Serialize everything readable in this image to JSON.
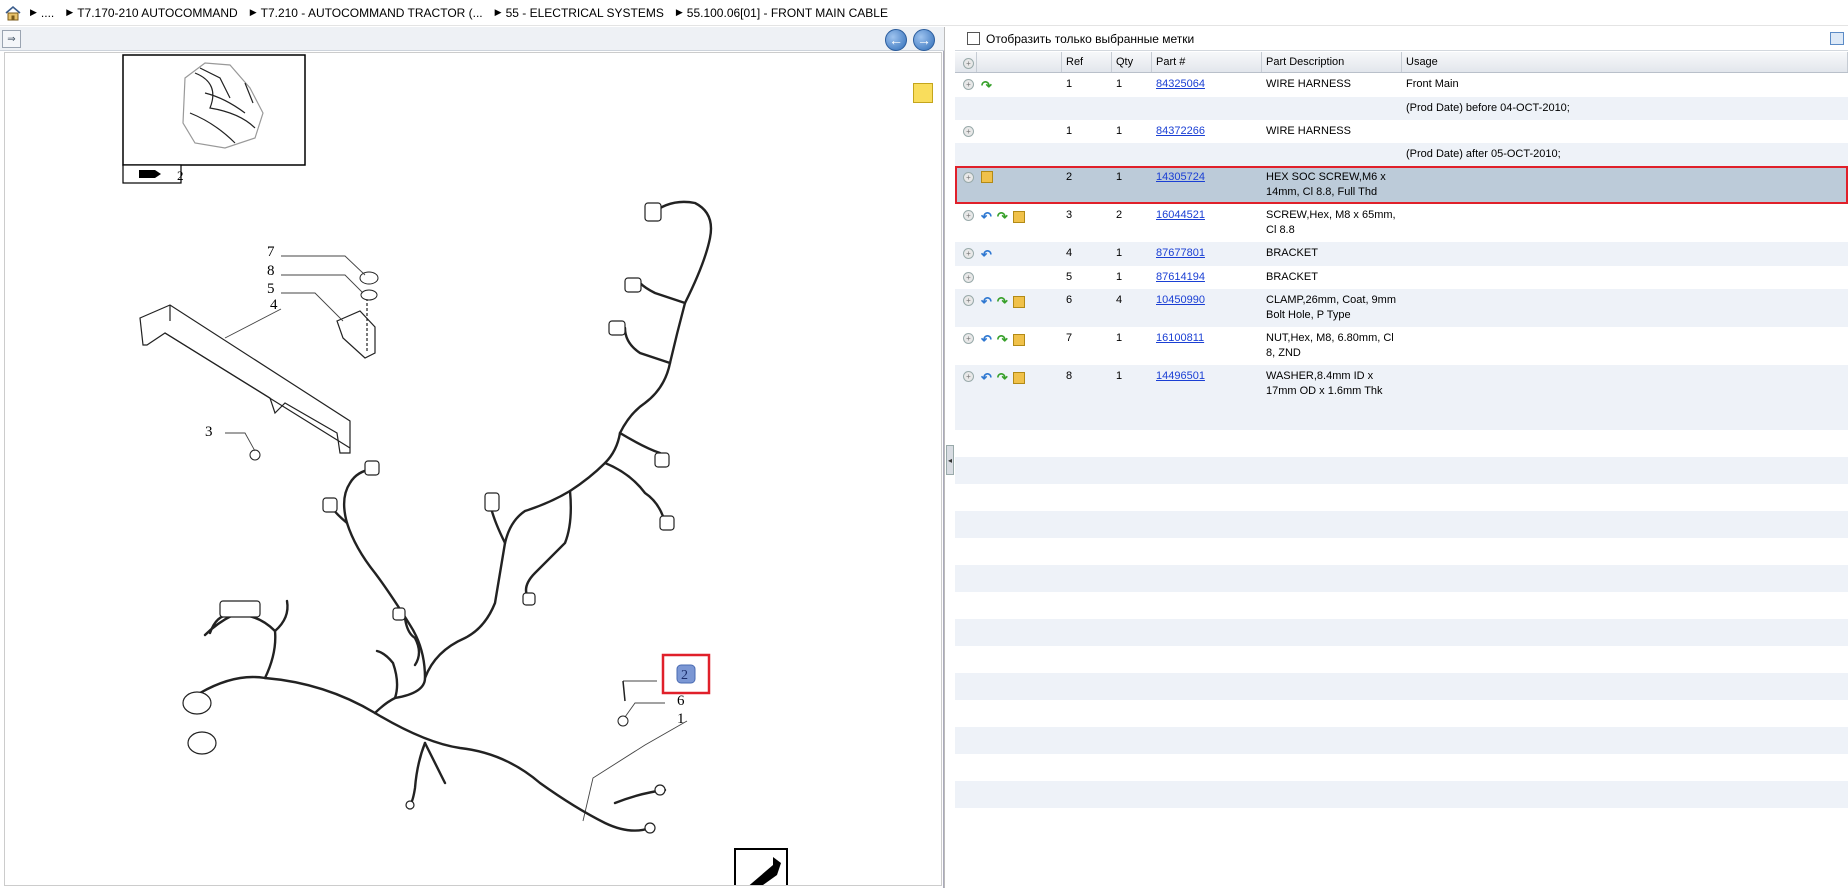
{
  "breadcrumb": [
    {
      "label": "...."
    },
    {
      "label": "T7.170-210 AUTOCOMMAND"
    },
    {
      "label": "T7.210 - AUTOCOMMAND TRACTOR (..."
    },
    {
      "label": "55 - ELECTRICAL SYSTEMS"
    },
    {
      "label": "55.100.06[01] - FRONT MAIN CABLE"
    }
  ],
  "filter": {
    "label": "Отобразить только выбранные метки"
  },
  "grid": {
    "headers": [
      "Ref",
      "Qty",
      "Part #",
      "Part Description",
      "Usage"
    ],
    "rows": [
      {
        "ref": "1",
        "qty": "1",
        "part": "84325064",
        "desc": "WIRE HARNESS",
        "usage": "Front Main",
        "icons": [
          "fwd"
        ],
        "alt": false
      },
      {
        "ref": "",
        "qty": "",
        "part": "",
        "desc": "",
        "usage": "(Prod Date) before 04-OCT-2010;",
        "icons": [],
        "alt": true
      },
      {
        "ref": "1",
        "qty": "1",
        "part": "84372266",
        "desc": "WIRE HARNESS",
        "usage": "",
        "icons": [],
        "alt": false
      },
      {
        "ref": "",
        "qty": "",
        "part": "",
        "desc": "",
        "usage": "(Prod Date) after 05-OCT-2010;",
        "icons": [],
        "alt": true
      },
      {
        "ref": "2",
        "qty": "1",
        "part": "14305724",
        "desc": "HEX SOC SCREW,M6 x 14mm, Cl 8.8, Full Thd",
        "usage": "",
        "icons": [
          "box"
        ],
        "selected": true
      },
      {
        "ref": "3",
        "qty": "2",
        "part": "16044521",
        "desc": "SCREW,Hex, M8 x 65mm, Cl 8.8",
        "usage": "",
        "icons": [
          "back",
          "fwd",
          "box"
        ],
        "alt": false
      },
      {
        "ref": "4",
        "qty": "1",
        "part": "87677801",
        "desc": "BRACKET",
        "usage": "",
        "icons": [
          "back"
        ],
        "alt": true
      },
      {
        "ref": "5",
        "qty": "1",
        "part": "87614194",
        "desc": "BRACKET",
        "usage": "",
        "icons": [],
        "alt": false
      },
      {
        "ref": "6",
        "qty": "4",
        "part": "10450990",
        "desc": "CLAMP,26mm, Coat, 9mm Bolt Hole, P Type",
        "usage": "",
        "icons": [
          "back",
          "fwd",
          "box"
        ],
        "alt": true
      },
      {
        "ref": "7",
        "qty": "1",
        "part": "16100811",
        "desc": "NUT,Hex, M8, 6.80mm, Cl 8, ZND",
        "usage": "",
        "icons": [
          "back",
          "fwd",
          "box"
        ],
        "alt": false
      },
      {
        "ref": "8",
        "qty": "1",
        "part": "14496501",
        "desc": "WASHER,8.4mm ID x 17mm OD x 1.6mm Thk",
        "usage": "",
        "icons": [
          "back",
          "fwd",
          "box"
        ],
        "alt": true
      }
    ]
  },
  "drawing": {
    "callouts": [
      "7",
      "8",
      "5",
      "4",
      "3",
      "2",
      "6",
      "1"
    ],
    "thumbnail_label": "2"
  },
  "colors": {
    "selection_outline": "#e0202a",
    "selected_row": "#bccbd9",
    "link": "#1a3fd4"
  }
}
